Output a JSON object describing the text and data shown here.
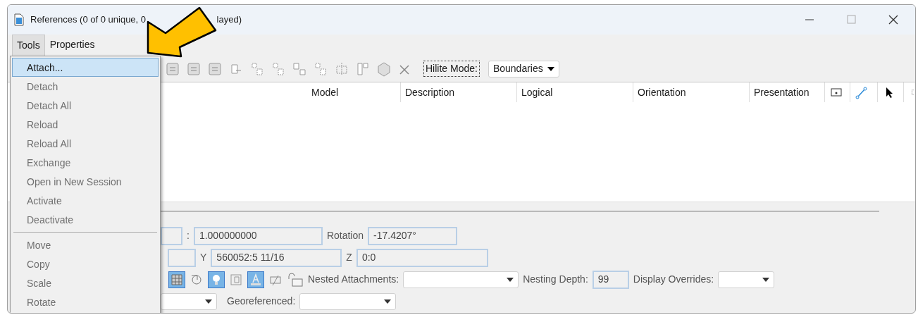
{
  "window": {
    "title_start": "References (0 of 0 unique, 0",
    "title_end": "layed)"
  },
  "menubar": [
    {
      "label": "Tools",
      "selected": true
    },
    {
      "label": "Properties",
      "selected": false
    }
  ],
  "menu": [
    {
      "kind": "item",
      "label": "Attach...",
      "selected": true,
      "disabled": false
    },
    {
      "kind": "item",
      "label": "Detach",
      "selected": false,
      "disabled": true
    },
    {
      "kind": "item",
      "label": "Detach All",
      "selected": false,
      "disabled": true
    },
    {
      "kind": "item",
      "label": "Reload",
      "selected": false,
      "disabled": true
    },
    {
      "kind": "item",
      "label": "Reload All",
      "selected": false,
      "disabled": true
    },
    {
      "kind": "item",
      "label": "Exchange",
      "selected": false,
      "disabled": true
    },
    {
      "kind": "item",
      "label": "Open in New Session",
      "selected": false,
      "disabled": true
    },
    {
      "kind": "item",
      "label": "Activate",
      "selected": false,
      "disabled": true
    },
    {
      "kind": "item",
      "label": "Deactivate",
      "selected": false,
      "disabled": true
    },
    {
      "kind": "separator"
    },
    {
      "kind": "item",
      "label": "Move",
      "selected": false,
      "disabled": true
    },
    {
      "kind": "item",
      "label": "Copy",
      "selected": false,
      "disabled": true
    },
    {
      "kind": "item",
      "label": "Scale",
      "selected": false,
      "disabled": true
    },
    {
      "kind": "item",
      "label": "Rotate",
      "selected": false,
      "disabled": true
    }
  ],
  "toolbar": {
    "hilite_label": "Hilite Mode:",
    "hilite_value": "Boundaries"
  },
  "table": {
    "columns": [
      "Model",
      "Description",
      "Logical",
      "Orientation",
      "Presentation"
    ]
  },
  "bottom": {
    "scale_separator": ":",
    "scale_value": "1.000000000",
    "rotation_label": "Rotation",
    "rotation_value": "-17.4207°",
    "y_label": "Y",
    "y_value": "560052:5 11/16",
    "z_label": "Z",
    "z_value": "0:0",
    "toggles": [
      {
        "kind": "grid",
        "on": true
      },
      {
        "kind": "clip",
        "on": false
      },
      {
        "kind": "bulb",
        "on": true
      },
      {
        "kind": "raster",
        "on": false
      },
      {
        "kind": "text",
        "on": true
      },
      {
        "kind": "note",
        "on": false
      }
    ],
    "nested_label": "Nested Attachments:",
    "depth_label": "Nesting Depth:",
    "depth_value": "99",
    "overrides_label": "Display Overrides:",
    "georef_label": "Georeferenced:"
  }
}
